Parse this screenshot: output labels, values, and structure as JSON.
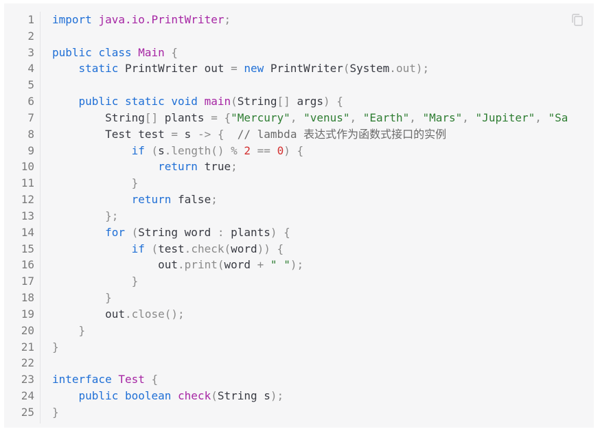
{
  "code_block": {
    "copy_icon": "copy-icon",
    "line_numbers": [
      "1",
      "2",
      "3",
      "4",
      "5",
      "6",
      "7",
      "8",
      "9",
      "10",
      "11",
      "12",
      "13",
      "14",
      "15",
      "16",
      "17",
      "18",
      "19",
      "20",
      "21",
      "22",
      "23",
      "24",
      "25"
    ],
    "lines": [
      [
        {
          "t": "import ",
          "c": "kw"
        },
        {
          "t": "java.io.PrintWriter",
          "c": "class"
        },
        {
          "t": ";",
          "c": "punc"
        }
      ],
      [],
      [
        {
          "t": "public ",
          "c": "kw"
        },
        {
          "t": "class ",
          "c": "kw"
        },
        {
          "t": "Main ",
          "c": "class"
        },
        {
          "t": "{",
          "c": "punc"
        }
      ],
      [
        {
          "t": "    static ",
          "c": "kw"
        },
        {
          "t": "PrintWriter ",
          "c": "type"
        },
        {
          "t": "out ",
          "c": "var"
        },
        {
          "t": "= ",
          "c": "op"
        },
        {
          "t": "new ",
          "c": "kw"
        },
        {
          "t": "PrintWriter",
          "c": "type"
        },
        {
          "t": "(",
          "c": "punc"
        },
        {
          "t": "System",
          "c": "type"
        },
        {
          "t": ".",
          "c": "punc"
        },
        {
          "t": "out",
          "c": "prop"
        },
        {
          "t": ");",
          "c": "punc"
        }
      ],
      [],
      [
        {
          "t": "    public ",
          "c": "kw"
        },
        {
          "t": "static ",
          "c": "kw"
        },
        {
          "t": "void ",
          "c": "kw"
        },
        {
          "t": "main",
          "c": "fn"
        },
        {
          "t": "(",
          "c": "punc"
        },
        {
          "t": "String",
          "c": "type"
        },
        {
          "t": "[] ",
          "c": "punc"
        },
        {
          "t": "args",
          "c": "var"
        },
        {
          "t": ") {",
          "c": "punc"
        }
      ],
      [
        {
          "t": "        String",
          "c": "type"
        },
        {
          "t": "[] ",
          "c": "punc"
        },
        {
          "t": "plants ",
          "c": "var"
        },
        {
          "t": "= ",
          "c": "op"
        },
        {
          "t": "{",
          "c": "punc"
        },
        {
          "t": "\"Mercury\"",
          "c": "str"
        },
        {
          "t": ", ",
          "c": "punc"
        },
        {
          "t": "\"venus\"",
          "c": "str"
        },
        {
          "t": ", ",
          "c": "punc"
        },
        {
          "t": "\"Earth\"",
          "c": "str"
        },
        {
          "t": ", ",
          "c": "punc"
        },
        {
          "t": "\"Mars\"",
          "c": "str"
        },
        {
          "t": ", ",
          "c": "punc"
        },
        {
          "t": "\"Jupiter\"",
          "c": "str"
        },
        {
          "t": ", ",
          "c": "punc"
        },
        {
          "t": "\"Sa",
          "c": "str"
        }
      ],
      [
        {
          "t": "        Test ",
          "c": "type"
        },
        {
          "t": "test ",
          "c": "var"
        },
        {
          "t": "= ",
          "c": "op"
        },
        {
          "t": "s ",
          "c": "var"
        },
        {
          "t": "-> ",
          "c": "op"
        },
        {
          "t": "{  ",
          "c": "punc"
        },
        {
          "t": "// lambda 表达式作为函数式接口的实例",
          "c": "cm"
        }
      ],
      [
        {
          "t": "            if ",
          "c": "kw"
        },
        {
          "t": "(",
          "c": "punc"
        },
        {
          "t": "s",
          "c": "var"
        },
        {
          "t": ".",
          "c": "punc"
        },
        {
          "t": "length",
          "c": "prop"
        },
        {
          "t": "() ",
          "c": "punc"
        },
        {
          "t": "% ",
          "c": "op"
        },
        {
          "t": "2 ",
          "c": "num"
        },
        {
          "t": "== ",
          "c": "op"
        },
        {
          "t": "0",
          "c": "num"
        },
        {
          "t": ") {",
          "c": "punc"
        }
      ],
      [
        {
          "t": "                return ",
          "c": "kw"
        },
        {
          "t": "true",
          "c": "var"
        },
        {
          "t": ";",
          "c": "punc"
        }
      ],
      [
        {
          "t": "            }",
          "c": "punc"
        }
      ],
      [
        {
          "t": "            return ",
          "c": "kw"
        },
        {
          "t": "false",
          "c": "var"
        },
        {
          "t": ";",
          "c": "punc"
        }
      ],
      [
        {
          "t": "        };",
          "c": "punc"
        }
      ],
      [
        {
          "t": "        for ",
          "c": "kw"
        },
        {
          "t": "(",
          "c": "punc"
        },
        {
          "t": "String ",
          "c": "type"
        },
        {
          "t": "word ",
          "c": "var"
        },
        {
          "t": ": ",
          "c": "op"
        },
        {
          "t": "plants",
          "c": "var"
        },
        {
          "t": ") {",
          "c": "punc"
        }
      ],
      [
        {
          "t": "            if ",
          "c": "kw"
        },
        {
          "t": "(",
          "c": "punc"
        },
        {
          "t": "test",
          "c": "var"
        },
        {
          "t": ".",
          "c": "punc"
        },
        {
          "t": "check",
          "c": "prop"
        },
        {
          "t": "(",
          "c": "punc"
        },
        {
          "t": "word",
          "c": "var"
        },
        {
          "t": ")) {",
          "c": "punc"
        }
      ],
      [
        {
          "t": "                out",
          "c": "var"
        },
        {
          "t": ".",
          "c": "punc"
        },
        {
          "t": "print",
          "c": "prop"
        },
        {
          "t": "(",
          "c": "punc"
        },
        {
          "t": "word ",
          "c": "var"
        },
        {
          "t": "+ ",
          "c": "op"
        },
        {
          "t": "\" \"",
          "c": "str"
        },
        {
          "t": ");",
          "c": "punc"
        }
      ],
      [
        {
          "t": "            }",
          "c": "punc"
        }
      ],
      [
        {
          "t": "        }",
          "c": "punc"
        }
      ],
      [
        {
          "t": "        out",
          "c": "var"
        },
        {
          "t": ".",
          "c": "punc"
        },
        {
          "t": "close",
          "c": "prop"
        },
        {
          "t": "();",
          "c": "punc"
        }
      ],
      [
        {
          "t": "    }",
          "c": "punc"
        }
      ],
      [
        {
          "t": "}",
          "c": "punc"
        }
      ],
      [],
      [
        {
          "t": "interface ",
          "c": "kw"
        },
        {
          "t": "Test ",
          "c": "class"
        },
        {
          "t": "{",
          "c": "punc"
        }
      ],
      [
        {
          "t": "    public ",
          "c": "kw"
        },
        {
          "t": "boolean ",
          "c": "kw"
        },
        {
          "t": "check",
          "c": "fn"
        },
        {
          "t": "(",
          "c": "punc"
        },
        {
          "t": "String ",
          "c": "type"
        },
        {
          "t": "s",
          "c": "var"
        },
        {
          "t": ");",
          "c": "punc"
        }
      ],
      [
        {
          "t": "}",
          "c": "punc"
        }
      ]
    ]
  }
}
